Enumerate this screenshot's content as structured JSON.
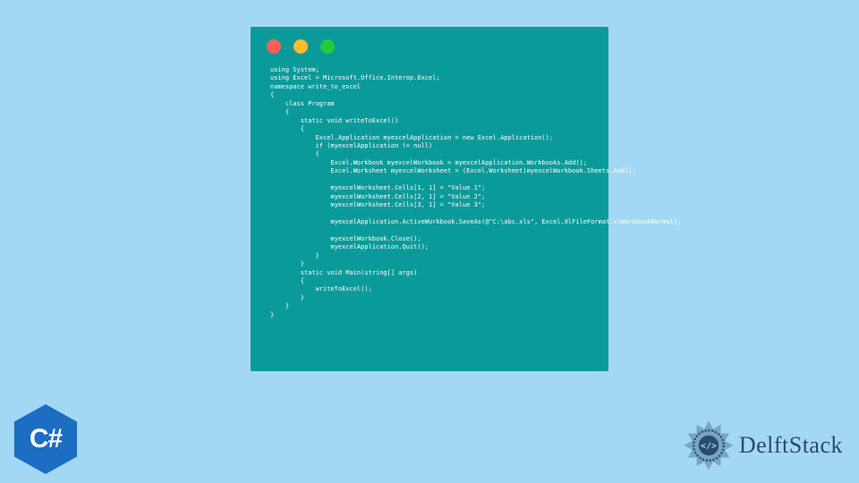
{
  "window": {
    "theme_bg": "#0b9a9a",
    "dots": [
      "red",
      "yellow",
      "green"
    ]
  },
  "code": {
    "text": "using System;\nusing Excel = Microsoft.Office.Interop.Excel;\nnamespace write_to_excel\n{\n    class Program\n    {\n        static void writeToExcel()\n        {\n            Excel.Application myexcelApplication = new Excel.Application();\n            if (myexcelApplication != null)\n            {\n                Excel.Workbook myexcelWorkbook = myexcelApplication.Workbooks.Add();\n                Excel.Worksheet myexcelWorksheet = (Excel.Worksheet)myexcelWorkbook.Sheets.Add();\n\n                myexcelWorksheet.Cells[1, 1] = \"Value 1\";\n                myexcelWorksheet.Cells[2, 1] = \"Value 2\";\n                myexcelWorksheet.Cells[3, 1] = \"Value 3\";\n\n                myexcelApplication.ActiveWorkbook.SaveAs(@\"C:\\abc.xls\", Excel.XlFileFormat.xlWorkbookNormal);\n\n                myexcelWorkbook.Close();\n                myexcelApplication.Quit();\n            }\n        }\n        static void Main(string[] args)\n        {\n            writeToExcel();\n        }\n    }\n}"
  },
  "logos": {
    "csharp_label": "C#",
    "brand_name": "DelftStack"
  },
  "colors": {
    "page_bg": "#a3d8f4",
    "accent_blue": "#1b6ec2",
    "brand_navy": "#2b4a6f"
  }
}
